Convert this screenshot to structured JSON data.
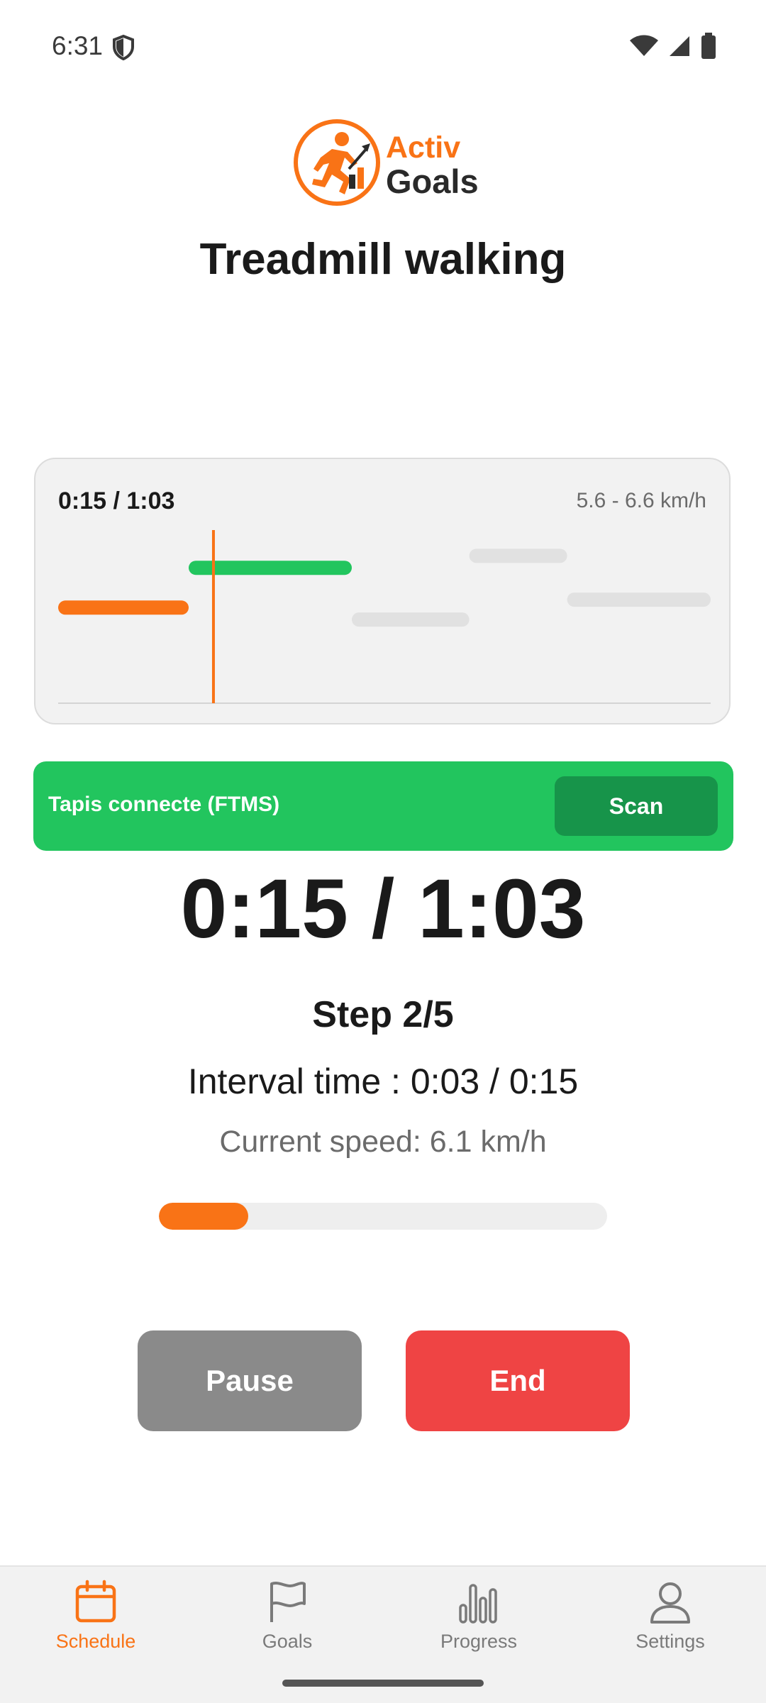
{
  "status_bar": {
    "time": "6:31"
  },
  "logo": {
    "line1": "Activ",
    "line2": "Goals"
  },
  "page": {
    "title": "Treadmill walking"
  },
  "chart_card": {
    "elapsed_total": "0:15 / 1:03",
    "speed_range": "5.6 - 6.6 km/h"
  },
  "chart_data": {
    "type": "bar",
    "segments": [
      {
        "step": 1,
        "status": "done",
        "color": "#f97316",
        "start": 0.0,
        "end": 0.2,
        "level": 0.24
      },
      {
        "step": 2,
        "status": "current",
        "color": "#22c55e",
        "start": 0.2,
        "end": 0.45,
        "level": 0.34
      },
      {
        "step": 3,
        "status": "upcoming",
        "color": "#e1e1e1",
        "start": 0.45,
        "end": 0.63,
        "level": 0.21
      },
      {
        "step": 4,
        "status": "upcoming",
        "color": "#e1e1e1",
        "start": 0.63,
        "end": 0.78,
        "level": 0.37
      },
      {
        "step": 5,
        "status": "upcoming",
        "color": "#e1e1e1",
        "start": 0.78,
        "end": 1.0,
        "level": 0.26
      }
    ],
    "cursor_position": 0.238,
    "cursor_color": "#f97316"
  },
  "ftms": {
    "label": "Tapis connecte (FTMS)",
    "scan_label": "Scan"
  },
  "timer": {
    "big": "0:15 / 1:03"
  },
  "step": {
    "label": "Step 2/5"
  },
  "interval": {
    "text": "Interval time : 0:03 / 0:15"
  },
  "speed": {
    "text": "Current speed: 6.1 km/h"
  },
  "progress": {
    "value": 0.2
  },
  "buttons": {
    "pause": "Pause",
    "end": "End"
  },
  "nav": [
    {
      "label": "Schedule",
      "icon": "calendar-icon",
      "active": true
    },
    {
      "label": "Goals",
      "icon": "flag-icon",
      "active": false
    },
    {
      "label": "Progress",
      "icon": "bar-chart-icon",
      "active": false
    },
    {
      "label": "Settings",
      "icon": "person-icon",
      "active": false
    }
  ],
  "colors": {
    "accent": "#f97316",
    "success": "#22c55e",
    "danger": "#ef4444",
    "muted": "#8a8a8a"
  }
}
